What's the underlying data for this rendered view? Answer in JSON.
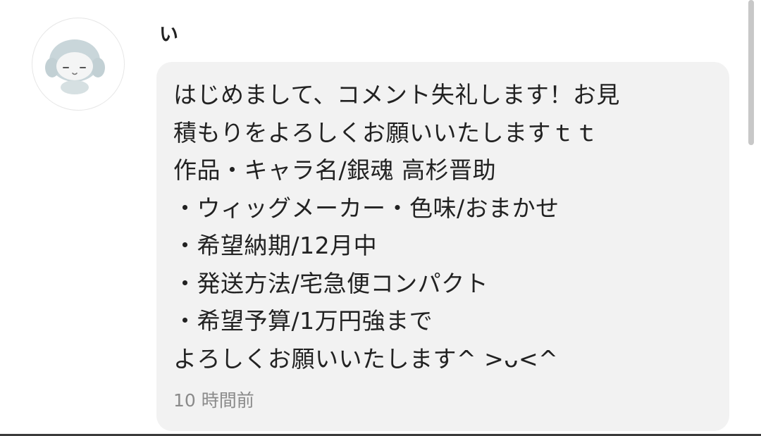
{
  "comment": {
    "avatar_icon": "character-avatar-icon",
    "username": "い",
    "message_lines": [
      "はじめまして、コメント失礼します！お見",
      "積もりをよろしくお願いいたしますｔｔ",
      "作品・キャラ名/銀魂 高杉晋助",
      "・ウィッグメーカー・色味/おまかせ",
      "・希望納期/12月中",
      "・発送方法/宅急便コンパクト",
      "・希望予算/1万円強まで",
      "よろしくお願いいたします^ >ᴗ<^"
    ],
    "timestamp": "10 時間前"
  },
  "colors": {
    "bubble_background": "#f2f2f2",
    "text": "#222222",
    "timestamp": "#8a8a8a"
  }
}
